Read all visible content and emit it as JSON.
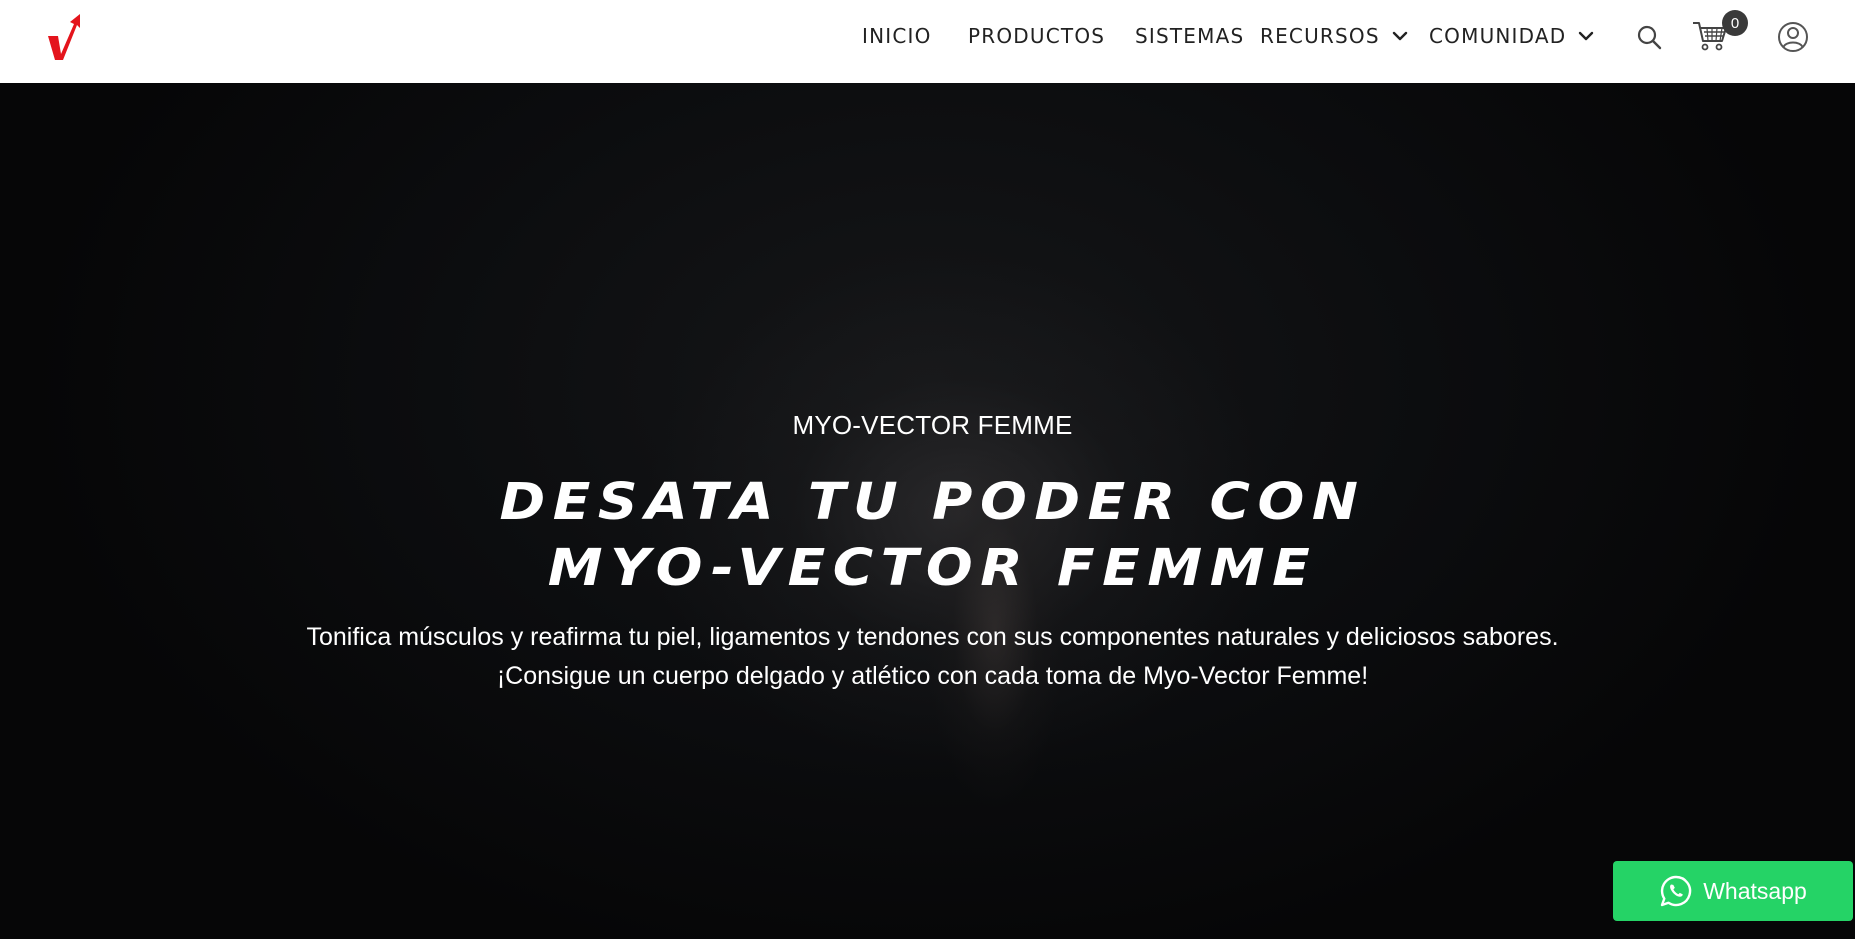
{
  "header": {
    "logo_alt": "V",
    "nav": [
      {
        "label": "INICIO",
        "has_dropdown": false
      },
      {
        "label": "PRODUCTOS",
        "has_dropdown": false
      },
      {
        "label": "SISTEMAS",
        "has_dropdown": false
      },
      {
        "label": "RECURSOS",
        "has_dropdown": true
      },
      {
        "label": "COMUNIDAD",
        "has_dropdown": true
      }
    ],
    "icons": {
      "search": "search-icon",
      "cart": "cart-icon",
      "account": "user-icon",
      "chevron": "chevron-down-icon"
    },
    "cart_count": "0"
  },
  "hero": {
    "eyebrow": "MYO-VECTOR FEMME",
    "headline_line1": "DESATA TU PODER CON",
    "headline_line2": "MYO-VECTOR FEMME",
    "subtext_line1": "Tonifica músculos y reafirma tu piel, ligamentos y tendones con sus componentes naturales y deliciosos sabores.",
    "subtext_line2": "¡Consigue un cuerpo delgado y atlético con cada toma de Myo-Vector Femme!"
  },
  "whatsapp": {
    "label": "Whatsapp",
    "icon": "whatsapp-icon"
  },
  "colors": {
    "logo_red": "#e4141c",
    "header_bg": "#ffffff",
    "nav_text": "#222222",
    "hero_bg": "#0c0d0f",
    "badge_bg": "#3a3a3a",
    "whatsapp_green": "#25d366"
  }
}
